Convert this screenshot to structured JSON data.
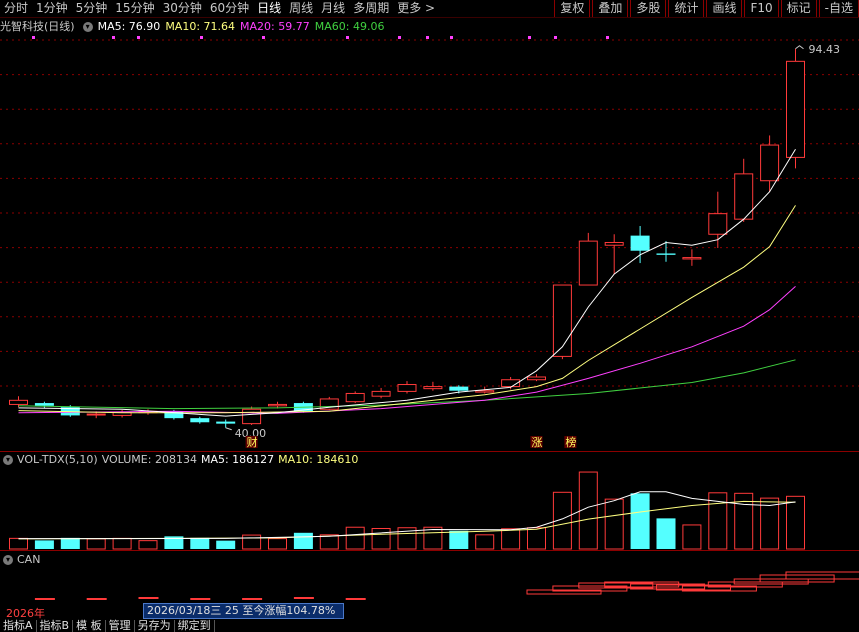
{
  "toolbar": {
    "periods": [
      "分时",
      "1分钟",
      "5分钟",
      "15分钟",
      "30分钟",
      "60分钟",
      "日线",
      "周线",
      "月线",
      "多周期",
      "更多 >"
    ],
    "active_period": "日线",
    "buttons": [
      "复权",
      "叠加",
      "多股",
      "统计",
      "画线",
      "F10",
      "标记",
      "-自选"
    ]
  },
  "stock": {
    "title": "光智科技(日线)",
    "ma5": "MA5: 76.90",
    "ma10": "MA10: 71.64",
    "ma20": "MA20: 59.77",
    "ma60": "MA60: 49.06"
  },
  "colors": {
    "up": "#ff3a3a",
    "down": "#54ffff",
    "ma5": "#ffffff",
    "ma10": "#ffff80",
    "ma20": "#ff40ff",
    "ma60": "#40d040",
    "grid": "#8b0000"
  },
  "price": {
    "high_label": "94.43",
    "low_label": "40.00",
    "markers": [
      "财",
      "涨",
      "榜"
    ]
  },
  "volume_panel": {
    "title": "VOL-TDX(5,10)",
    "volume": "VOLUME: 208134",
    "ma5": "MA5: 186127",
    "ma10": "MA10: 184610"
  },
  "can_panel": {
    "title": "CAN"
  },
  "status": {
    "year": "2026年",
    "range_text": "2026/03/18三 25 至今涨幅104.78%",
    "tabs": [
      "指标A",
      "指标B",
      "模 板",
      "管理",
      "另存为",
      "绑定到"
    ]
  },
  "chart_data": {
    "type": "candlestick",
    "title": "光智科技(日线)",
    "price_ylim": [
      38,
      96
    ],
    "candles": [
      {
        "o": 42.6,
        "c": 43.2,
        "h": 43.8,
        "l": 42.2,
        "v": 42000
      },
      {
        "o": 42.8,
        "c": 42.4,
        "h": 43.0,
        "l": 42.0,
        "v": 34000
      },
      {
        "o": 42.2,
        "c": 41.0,
        "h": 42.5,
        "l": 40.8,
        "v": 44000
      },
      {
        "o": 41.1,
        "c": 41.2,
        "h": 41.6,
        "l": 40.6,
        "v": 40000
      },
      {
        "o": 41.0,
        "c": 41.5,
        "h": 41.8,
        "l": 40.7,
        "v": 42000
      },
      {
        "o": 41.4,
        "c": 41.6,
        "h": 41.9,
        "l": 41.1,
        "v": 33000
      },
      {
        "o": 41.6,
        "c": 40.6,
        "h": 41.8,
        "l": 40.4,
        "v": 50000
      },
      {
        "o": 40.6,
        "c": 40.0,
        "h": 40.8,
        "l": 39.8,
        "v": 44000
      },
      {
        "o": 40.1,
        "c": 39.8,
        "h": 40.4,
        "l": 39.2,
        "v": 33000
      },
      {
        "o": 39.8,
        "c": 41.9,
        "h": 42.3,
        "l": 39.6,
        "v": 55000
      },
      {
        "o": 42.4,
        "c": 42.6,
        "h": 43.0,
        "l": 42.0,
        "v": 41000
      },
      {
        "o": 42.8,
        "c": 41.6,
        "h": 43.0,
        "l": 41.4,
        "v": 64000
      },
      {
        "o": 41.9,
        "c": 43.4,
        "h": 43.7,
        "l": 41.8,
        "v": 56000
      },
      {
        "o": 43.0,
        "c": 44.2,
        "h": 44.5,
        "l": 42.8,
        "v": 86000
      },
      {
        "o": 43.8,
        "c": 44.5,
        "h": 45.0,
        "l": 43.5,
        "v": 81000
      },
      {
        "o": 44.5,
        "c": 45.5,
        "h": 46.0,
        "l": 44.2,
        "v": 84000
      },
      {
        "o": 44.9,
        "c": 45.2,
        "h": 45.9,
        "l": 44.6,
        "v": 86000
      },
      {
        "o": 45.2,
        "c": 44.6,
        "h": 45.4,
        "l": 44.2,
        "v": 72000
      },
      {
        "o": 44.4,
        "c": 44.6,
        "h": 45.2,
        "l": 44.2,
        "v": 56000
      },
      {
        "o": 45.2,
        "c": 46.2,
        "h": 46.6,
        "l": 44.8,
        "v": 80000
      },
      {
        "o": 46.2,
        "c": 46.6,
        "h": 47.0,
        "l": 46.0,
        "v": 84000
      },
      {
        "o": 49.6,
        "c": 60.0,
        "h": 60.0,
        "l": 49.2,
        "v": 224000
      },
      {
        "o": 60.0,
        "c": 66.4,
        "h": 67.6,
        "l": 60.0,
        "v": 304000
      },
      {
        "o": 65.8,
        "c": 66.2,
        "h": 67.4,
        "l": 61.6,
        "v": 197000
      },
      {
        "o": 67.2,
        "c": 65.0,
        "h": 68.6,
        "l": 63.2,
        "v": 220000
      },
      {
        "o": 64.6,
        "c": 64.4,
        "h": 66.4,
        "l": 63.4,
        "v": 121000
      },
      {
        "o": 63.8,
        "c": 64.0,
        "h": 65.2,
        "l": 62.8,
        "v": 95000
      },
      {
        "o": 67.4,
        "c": 70.4,
        "h": 73.6,
        "l": 65.4,
        "v": 222000
      },
      {
        "o": 69.6,
        "c": 76.2,
        "h": 78.4,
        "l": 69.2,
        "v": 220000
      },
      {
        "o": 75.2,
        "c": 80.4,
        "h": 81.8,
        "l": 73.6,
        "v": 201000
      },
      {
        "o": 78.6,
        "c": 92.6,
        "h": 94.43,
        "l": 77.0,
        "v": 208134
      }
    ],
    "ma5": [
      [
        0,
        42.1
      ],
      [
        4,
        41.9
      ],
      [
        8,
        40.9
      ],
      [
        10,
        41.4
      ],
      [
        12,
        42.2
      ],
      [
        15,
        43.2
      ],
      [
        17,
        44.4
      ],
      [
        19,
        45.1
      ],
      [
        20,
        47.5
      ],
      [
        21,
        51.0
      ],
      [
        22,
        56.8
      ],
      [
        23,
        61.6
      ],
      [
        24,
        64.4
      ],
      [
        25,
        66.2
      ],
      [
        26,
        65.8
      ],
      [
        27,
        66.6
      ],
      [
        28,
        69.6
      ],
      [
        29,
        73.6
      ],
      [
        30,
        79.8
      ]
    ],
    "ma10": [
      [
        0,
        41.7
      ],
      [
        4,
        41.4
      ],
      [
        8,
        41.4
      ],
      [
        12,
        41.6
      ],
      [
        15,
        42.8
      ],
      [
        18,
        44.0
      ],
      [
        20,
        45.2
      ],
      [
        21,
        46.4
      ],
      [
        22,
        49.0
      ],
      [
        24,
        53.6
      ],
      [
        26,
        58.2
      ],
      [
        28,
        62.6
      ],
      [
        29,
        65.6
      ],
      [
        30,
        71.6
      ]
    ],
    "ma20": [
      [
        0,
        41.4
      ],
      [
        6,
        41.6
      ],
      [
        10,
        41.3
      ],
      [
        14,
        42.0
      ],
      [
        18,
        43.2
      ],
      [
        20,
        44.4
      ],
      [
        22,
        46.4
      ],
      [
        24,
        48.6
      ],
      [
        26,
        51.0
      ],
      [
        28,
        54.0
      ],
      [
        29,
        56.4
      ],
      [
        30,
        59.8
      ]
    ],
    "ma60": [
      [
        0,
        42.4
      ],
      [
        6,
        42.0
      ],
      [
        10,
        42.1
      ],
      [
        14,
        42.5
      ],
      [
        18,
        43.2
      ],
      [
        22,
        44.2
      ],
      [
        26,
        45.8
      ],
      [
        28,
        47.2
      ],
      [
        30,
        49.1
      ]
    ],
    "vol_ylim": [
      0,
      320000
    ],
    "vol_ma5": [
      [
        0,
        41000
      ],
      [
        4,
        41000
      ],
      [
        8,
        42000
      ],
      [
        12,
        50000
      ],
      [
        16,
        77000
      ],
      [
        19,
        76000
      ],
      [
        20,
        86000
      ],
      [
        21,
        119000
      ],
      [
        22,
        165000
      ],
      [
        23,
        191000
      ],
      [
        24,
        226000
      ],
      [
        25,
        226000
      ],
      [
        26,
        200000
      ],
      [
        27,
        188000
      ],
      [
        28,
        176000
      ],
      [
        29,
        172000
      ],
      [
        30,
        186127
      ]
    ],
    "vol_ma10": [
      [
        0,
        40000
      ],
      [
        6,
        42000
      ],
      [
        10,
        44000
      ],
      [
        14,
        58000
      ],
      [
        18,
        70000
      ],
      [
        20,
        78000
      ],
      [
        22,
        118000
      ],
      [
        24,
        146000
      ],
      [
        26,
        172000
      ],
      [
        28,
        188000
      ],
      [
        30,
        184610
      ]
    ]
  }
}
